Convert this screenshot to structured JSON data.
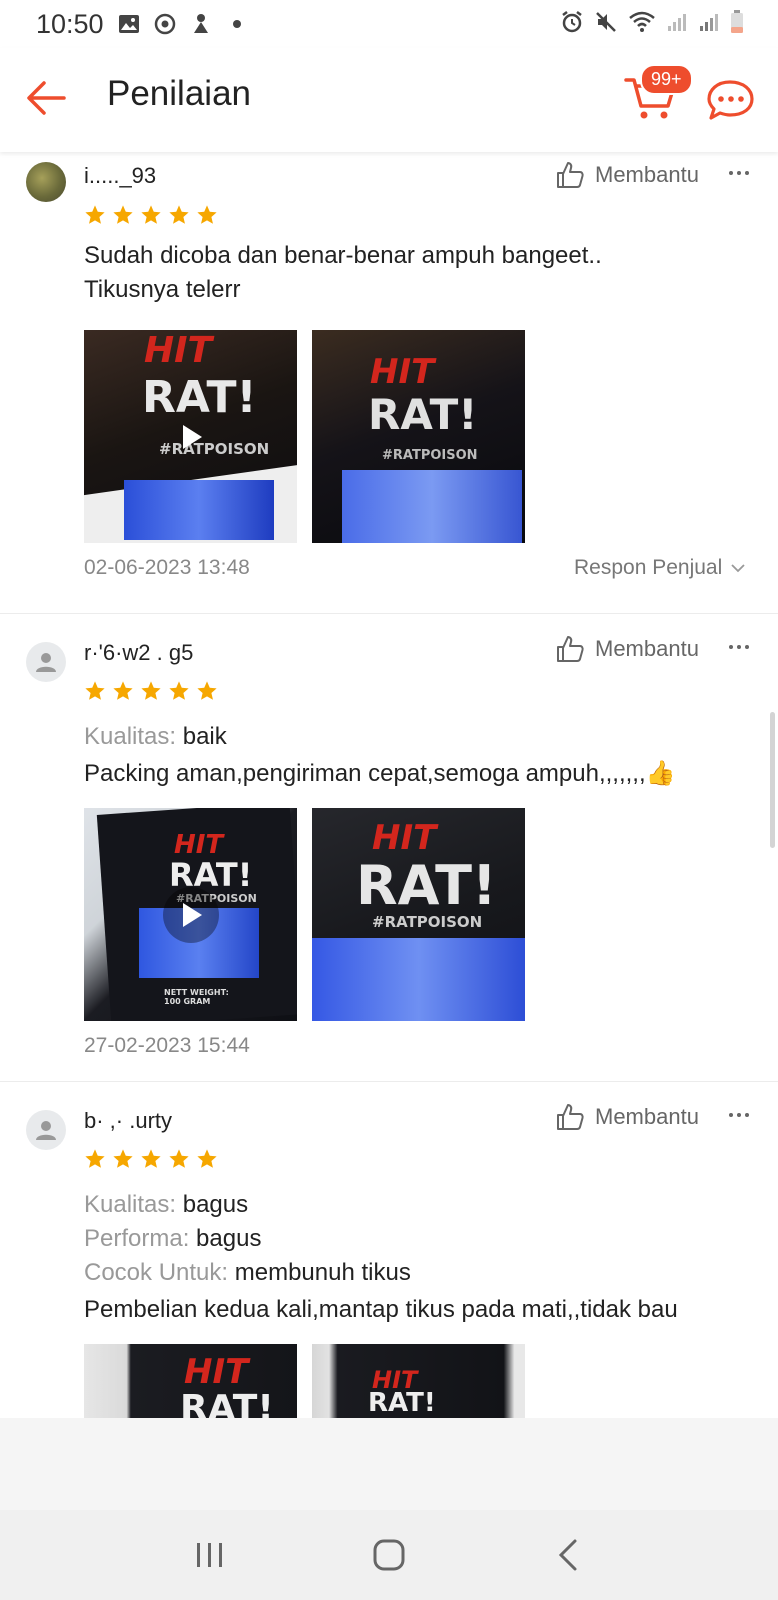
{
  "status_bar": {
    "time": "10:50"
  },
  "header": {
    "title": "Penilaian",
    "cart_badge": "99+"
  },
  "colors": {
    "accent": "#ee4d2d",
    "star": "#f6a700"
  },
  "reviews": [
    {
      "username": "i....._93",
      "helpful_label": "Membantu",
      "rating": 5,
      "attributes": [],
      "text_lines": [
        "Sudah dicoba dan benar-benar ampuh bangeet..",
        "Tikusnya telerr"
      ],
      "photos": [
        {
          "type": "video"
        },
        {
          "type": "image"
        }
      ],
      "timestamp": "02-06-2023 13:48",
      "seller_response_label": "Respon Penjual"
    },
    {
      "username": "r·'6·w2 . g5",
      "helpful_label": "Membantu",
      "rating": 5,
      "attributes": [
        {
          "key": "Kualitas:",
          "value": "baik"
        }
      ],
      "text_lines": [
        "Packing aman,pengiriman cepat,semoga ampuh,,,,,,,👍"
      ],
      "photos": [
        {
          "type": "video"
        },
        {
          "type": "image"
        }
      ],
      "timestamp": "27-02-2023 15:44"
    },
    {
      "username": "b· ,· .urty",
      "helpful_label": "Membantu",
      "rating": 5,
      "attributes": [
        {
          "key": "Kualitas:",
          "value": "bagus"
        },
        {
          "key": "Performa:",
          "value": "bagus"
        },
        {
          "key": "Cocok Untuk:",
          "value": "membunuh tikus"
        }
      ],
      "text_lines": [
        "Pembelian kedua kali,mantap tikus pada mati,,tidak bau"
      ],
      "photos": [
        {
          "type": "image"
        },
        {
          "type": "image"
        }
      ]
    }
  ],
  "package_labels": {
    "brand_top": "HIT",
    "brand_main": "RAT!",
    "tag": "#RATPOISON",
    "weight": "NETT WEIGHT: 100 GRAM"
  },
  "icons": [
    "back-arrow-icon",
    "cart-icon",
    "chat-icon",
    "thumbs-up-icon",
    "more-icon",
    "star-icon",
    "play-icon",
    "chevron-down-icon",
    "user-icon"
  ]
}
